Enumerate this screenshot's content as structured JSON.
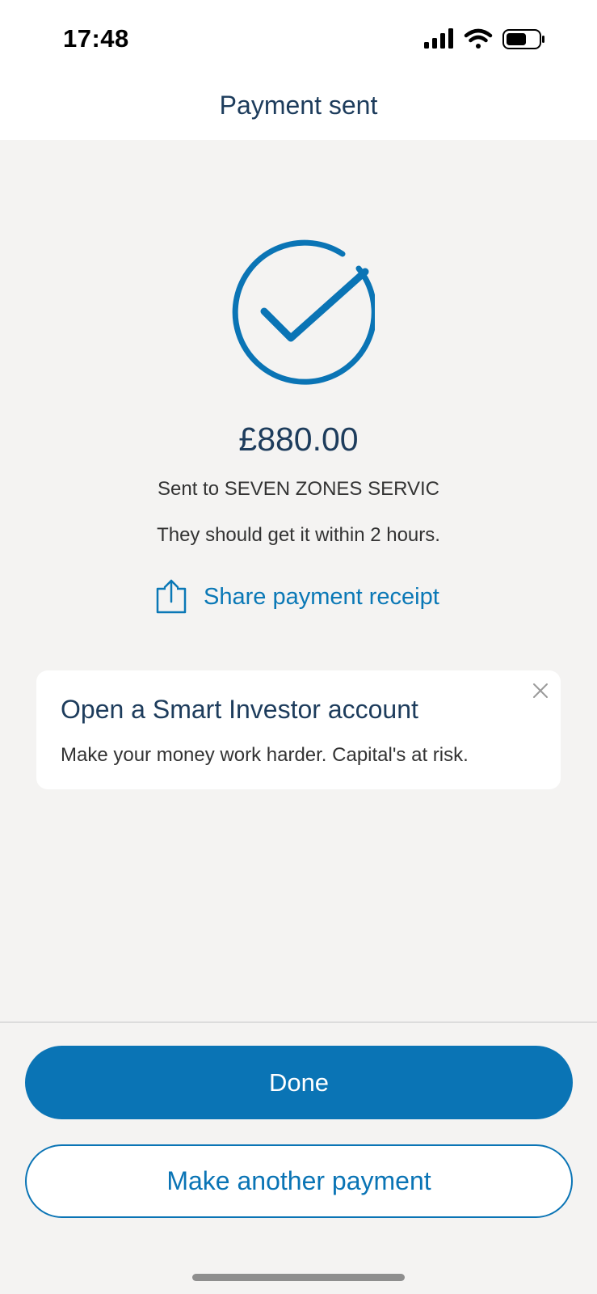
{
  "status_bar": {
    "time": "17:48",
    "icons": [
      "signal-icon",
      "wifi-icon",
      "battery-icon"
    ]
  },
  "nav": {
    "title": "Payment sent"
  },
  "confirmation": {
    "icon": "check-circle-icon",
    "amount": "£880.00",
    "sent_to": "Sent to SEVEN ZONES SERVIC",
    "eta": "They should get it within 2 hours."
  },
  "share": {
    "icon": "share-icon",
    "label": "Share payment receipt"
  },
  "promo": {
    "title": "Open a Smart Investor account",
    "body": "Make your money work harder. Capital's at risk.",
    "close_icon": "close-icon"
  },
  "actions": {
    "done_label": "Done",
    "another_label": "Make another payment"
  },
  "colors": {
    "accent": "#0a74b5",
    "title_text": "#1d3c5c",
    "background": "#f4f3f2",
    "card": "#ffffff"
  }
}
